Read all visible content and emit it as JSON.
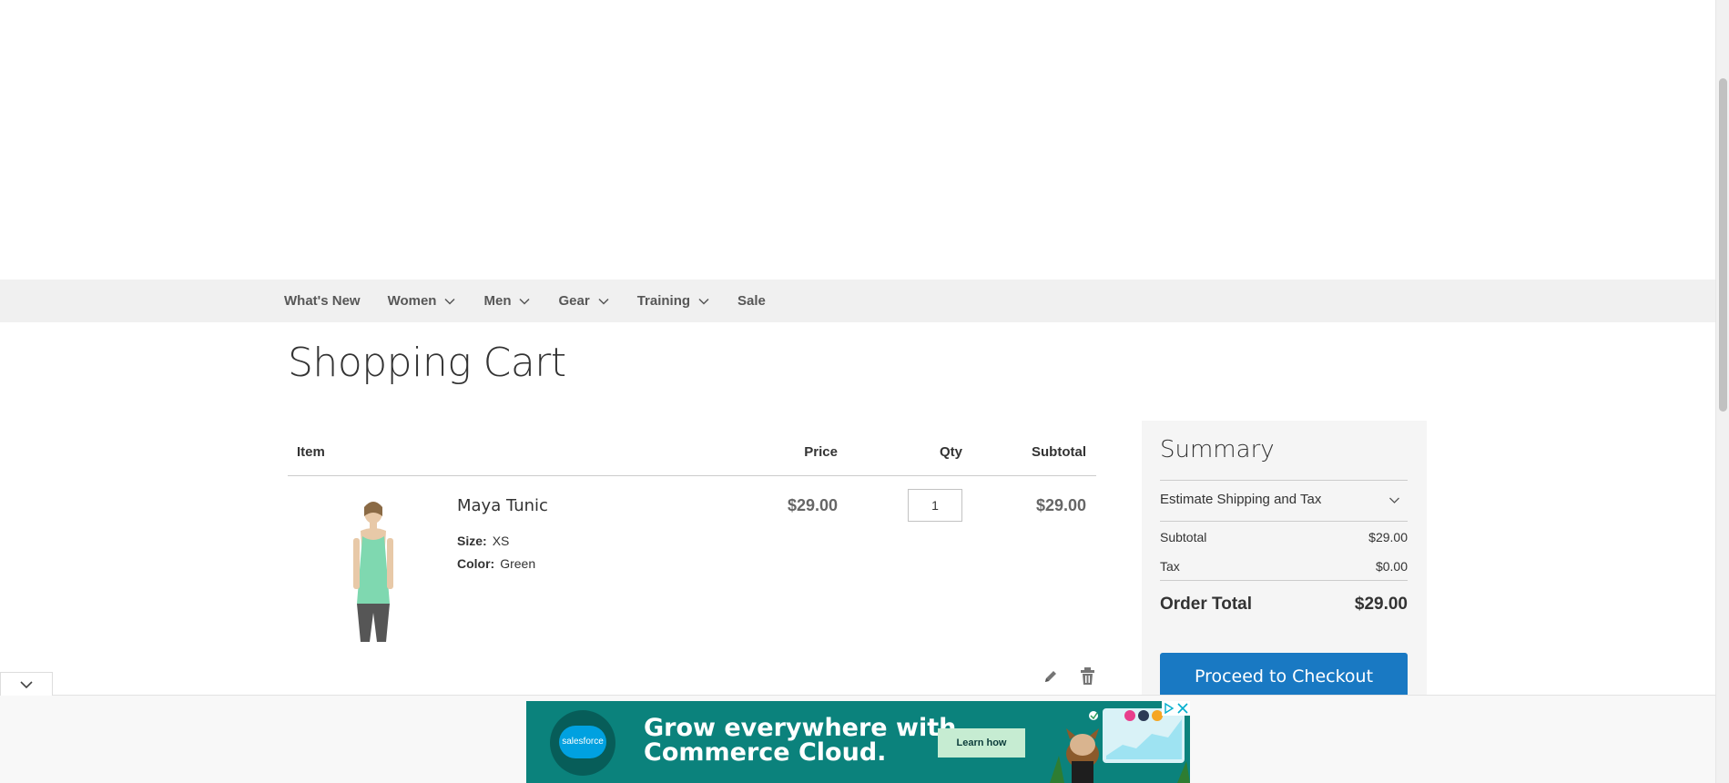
{
  "nav": {
    "items": [
      {
        "label": "What's New",
        "has_dropdown": false
      },
      {
        "label": "Women",
        "has_dropdown": true
      },
      {
        "label": "Men",
        "has_dropdown": true
      },
      {
        "label": "Gear",
        "has_dropdown": true
      },
      {
        "label": "Training",
        "has_dropdown": true
      },
      {
        "label": "Sale",
        "has_dropdown": false
      }
    ]
  },
  "page_title": "Shopping Cart",
  "cart": {
    "headers": {
      "item": "Item",
      "price": "Price",
      "qty": "Qty",
      "subtotal": "Subtotal"
    },
    "items": [
      {
        "name": "Maya Tunic",
        "options": [
          {
            "label": "Size:",
            "value": "XS"
          },
          {
            "label": "Color:",
            "value": "Green"
          }
        ],
        "price": "$29.00",
        "qty": "1",
        "subtotal": "$29.00",
        "image_icon": "green-tank-top-product-photo"
      }
    ],
    "actions": {
      "edit_icon": "pencil-icon",
      "delete_icon": "trash-icon"
    }
  },
  "summary": {
    "title": "Summary",
    "estimate_label": "Estimate Shipping and Tax",
    "rows": [
      {
        "label": "Subtotal",
        "value": "$29.00"
      },
      {
        "label": "Tax",
        "value": "$0.00"
      }
    ],
    "order_total_label": "Order Total",
    "order_total_value": "$29.00",
    "checkout_label": "Proceed to Checkout"
  },
  "ad": {
    "logo_text": "salesforce",
    "headline_line1": "Grow everywhere with",
    "headline_line2": "Commerce Cloud.",
    "cta_label": "Learn how"
  },
  "colors": {
    "nav_bg": "#f0f0f0",
    "primary_button": "#1979c3",
    "summary_bg": "#f5f5f5",
    "ad_bg": "#0b827c",
    "ad_button": "#c6ecd2"
  }
}
